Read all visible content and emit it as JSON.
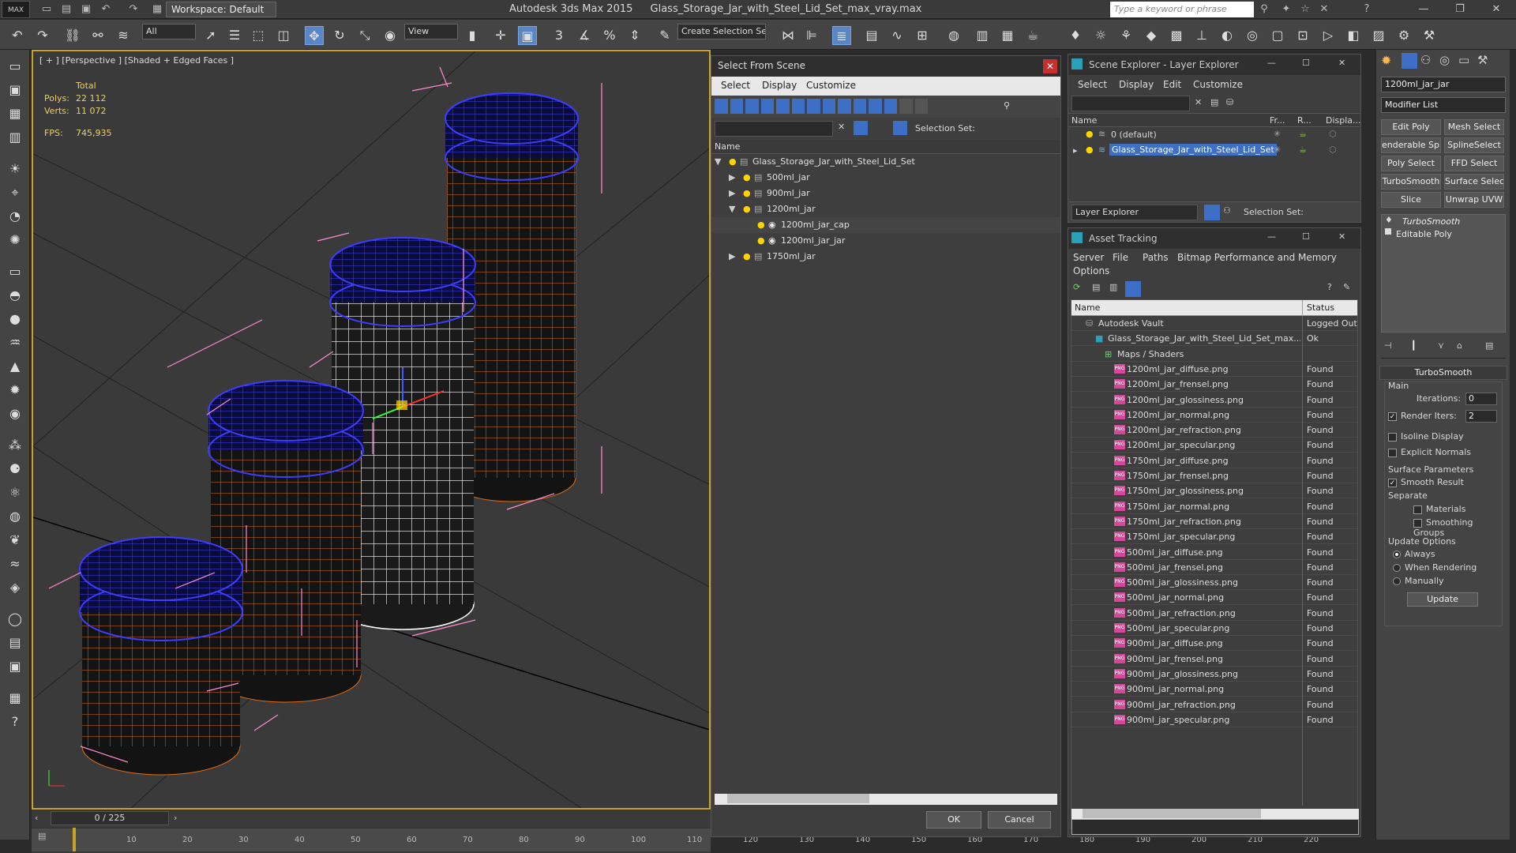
{
  "titlebar": {
    "logo": "MAX",
    "workspace": "Workspace: Default",
    "app_title": "Autodesk 3ds Max  2015",
    "file_title": "Glass_Storage_Jar_with_Steel_Lid_Set_max_vray.max",
    "search_placeholder": "Type a keyword or phrase"
  },
  "toolbar": {
    "filter_all": "All",
    "view": "View",
    "create_selection_set": "Create Selection Se"
  },
  "viewport": {
    "label": "[ + ] [Perspective ] [Shaded + Edged Faces ]",
    "stats_total": "Total",
    "polys_label": "Polys:",
    "polys": "22 112",
    "verts_label": "Verts:",
    "verts": "11 072",
    "fps_label": "FPS:",
    "fps": "745,935"
  },
  "timeline": {
    "frame": "0 / 225",
    "ticks": [
      "10",
      "20",
      "30",
      "40",
      "50",
      "60",
      "70",
      "80",
      "90",
      "100",
      "110",
      "120",
      "130",
      "140",
      "150",
      "160",
      "170",
      "180",
      "190",
      "200",
      "210",
      "220"
    ]
  },
  "select_from_scene": {
    "title": "Select From Scene",
    "menus": [
      "Select",
      "Display",
      "Customize"
    ],
    "selection_set": "Selection Set:",
    "col_name": "Name",
    "items": [
      {
        "label": "Glass_Storage_Jar_with_Steel_Lid_Set",
        "depth": 0,
        "arrow": "▼",
        "icon": "layer"
      },
      {
        "label": "500ml_jar",
        "depth": 1,
        "arrow": "▶",
        "icon": "group"
      },
      {
        "label": "900ml_jar",
        "depth": 1,
        "arrow": "▶",
        "icon": "group"
      },
      {
        "label": "1200ml_jar",
        "depth": 1,
        "arrow": "▼",
        "icon": "group"
      },
      {
        "label": "1200ml_jar_cap",
        "depth": 2,
        "arrow": "",
        "icon": "object"
      },
      {
        "label": "1200ml_jar_jar",
        "depth": 2,
        "arrow": "",
        "icon": "object"
      },
      {
        "label": "1750ml_jar",
        "depth": 1,
        "arrow": "▶",
        "icon": "group"
      }
    ],
    "ok": "OK",
    "cancel": "Cancel"
  },
  "scene_explorer": {
    "title": "Scene Explorer - Layer Explorer",
    "menus": [
      "Select",
      "Display",
      "Edit",
      "Customize"
    ],
    "cols": [
      "Name",
      "Fr...",
      "R...",
      "Displa..."
    ],
    "rows": [
      "0 (default)",
      "Glass_Storage_Jar_with_Steel_Lid_Set"
    ],
    "footer_combo": "Layer Explorer",
    "selection_set": "Selection Set:"
  },
  "asset_tracking": {
    "title": "Asset Tracking",
    "menus": [
      "Server",
      "File",
      "Paths",
      "Bitmap Performance and Memory"
    ],
    "menus2": [
      "Options"
    ],
    "col_name": "Name",
    "col_status": "Status",
    "rows": [
      {
        "name": "Autodesk Vault",
        "status": "Logged Out",
        "indent": 1,
        "icon": "vault"
      },
      {
        "name": "Glass_Storage_Jar_with_Steel_Lid_Set_max...",
        "status": "Ok",
        "indent": 2,
        "icon": "max"
      },
      {
        "name": "Maps / Shaders",
        "status": "",
        "indent": 3,
        "icon": "maps"
      },
      {
        "name": "1200ml_jar_diffuse.png",
        "status": "Found",
        "indent": 4,
        "icon": "png"
      },
      {
        "name": "1200ml_jar_frensel.png",
        "status": "Found",
        "indent": 4,
        "icon": "png"
      },
      {
        "name": "1200ml_jar_glossiness.png",
        "status": "Found",
        "indent": 4,
        "icon": "png"
      },
      {
        "name": "1200ml_jar_normal.png",
        "status": "Found",
        "indent": 4,
        "icon": "png"
      },
      {
        "name": "1200ml_jar_refraction.png",
        "status": "Found",
        "indent": 4,
        "icon": "png"
      },
      {
        "name": "1200ml_jar_specular.png",
        "status": "Found",
        "indent": 4,
        "icon": "png"
      },
      {
        "name": "1750ml_jar_diffuse.png",
        "status": "Found",
        "indent": 4,
        "icon": "png"
      },
      {
        "name": "1750ml_jar_frensel.png",
        "status": "Found",
        "indent": 4,
        "icon": "png"
      },
      {
        "name": "1750ml_jar_glossiness.png",
        "status": "Found",
        "indent": 4,
        "icon": "png"
      },
      {
        "name": "1750ml_jar_normal.png",
        "status": "Found",
        "indent": 4,
        "icon": "png"
      },
      {
        "name": "1750ml_jar_refraction.png",
        "status": "Found",
        "indent": 4,
        "icon": "png"
      },
      {
        "name": "1750ml_jar_specular.png",
        "status": "Found",
        "indent": 4,
        "icon": "png"
      },
      {
        "name": "500ml_jar_diffuse.png",
        "status": "Found",
        "indent": 4,
        "icon": "png"
      },
      {
        "name": "500ml_jar_frensel.png",
        "status": "Found",
        "indent": 4,
        "icon": "png"
      },
      {
        "name": "500ml_jar_glossiness.png",
        "status": "Found",
        "indent": 4,
        "icon": "png"
      },
      {
        "name": "500ml_jar_normal.png",
        "status": "Found",
        "indent": 4,
        "icon": "png"
      },
      {
        "name": "500ml_jar_refraction.png",
        "status": "Found",
        "indent": 4,
        "icon": "png"
      },
      {
        "name": "500ml_jar_specular.png",
        "status": "Found",
        "indent": 4,
        "icon": "png"
      },
      {
        "name": "900ml_jar_diffuse.png",
        "status": "Found",
        "indent": 4,
        "icon": "png"
      },
      {
        "name": "900ml_jar_frensel.png",
        "status": "Found",
        "indent": 4,
        "icon": "png"
      },
      {
        "name": "900ml_jar_glossiness.png",
        "status": "Found",
        "indent": 4,
        "icon": "png"
      },
      {
        "name": "900ml_jar_normal.png",
        "status": "Found",
        "indent": 4,
        "icon": "png"
      },
      {
        "name": "900ml_jar_refraction.png",
        "status": "Found",
        "indent": 4,
        "icon": "png"
      },
      {
        "name": "900ml_jar_specular.png",
        "status": "Found",
        "indent": 4,
        "icon": "png"
      }
    ]
  },
  "command_panel": {
    "object_name": "1200ml_jar_jar",
    "modifier_list": "Modifier List",
    "buttons": [
      "Edit Poly",
      "Mesh Select",
      "enderable Splir",
      "SplineSelect",
      "Poly Select",
      "FFD Select",
      "TurboSmooth",
      "Surface Select",
      "Slice",
      "Unwrap UVW"
    ],
    "stack": [
      "TurboSmooth",
      "Editable Poly"
    ],
    "rollout_title": "TurboSmooth",
    "main": "Main",
    "iterations_label": "Iterations:",
    "iterations": "0",
    "render_iters_label": "Render Iters:",
    "render_iters": "2",
    "isoline": "Isoline Display",
    "explicit_normals": "Explicit Normals",
    "surface_params": "Surface Parameters",
    "smooth_result": "Smooth Result",
    "separate": "Separate",
    "materials": "Materials",
    "smoothing_groups": "Smoothing Groups",
    "update_options": "Update Options",
    "always": "Always",
    "when_rendering": "When Rendering",
    "manually": "Manually",
    "update": "Update"
  }
}
